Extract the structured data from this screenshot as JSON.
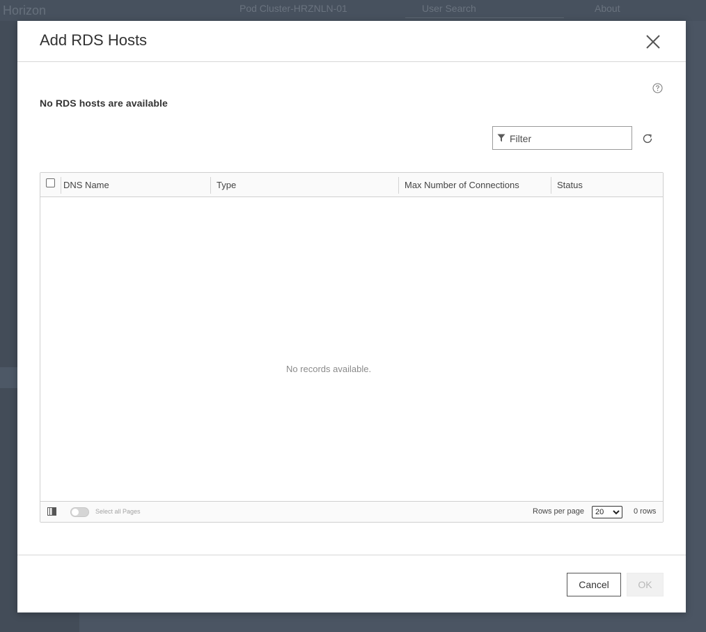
{
  "background": {
    "logo": "Horizon",
    "pod_name": "Pod Cluster-HRZNLN-01",
    "search_placeholder": "User Search",
    "about_label": "About"
  },
  "modal": {
    "title": "Add RDS Hosts",
    "message": "No RDS hosts are available",
    "filter_placeholder": "Filter",
    "table": {
      "columns": [
        "DNS Name",
        "Type",
        "Max Number of Connections",
        "Status"
      ],
      "rows": [],
      "empty_text": "No records available."
    },
    "footer": {
      "select_all_pages_label": "Select all Pages",
      "rows_per_page_label": "Rows per page",
      "rows_per_page_value": "20",
      "rows_per_page_options": [
        "20"
      ],
      "row_count_label": "0 rows"
    },
    "buttons": {
      "cancel": "Cancel",
      "ok": "OK"
    }
  },
  "icons": {
    "close": "close-icon",
    "help": "help-icon",
    "filter": "filter-icon",
    "refresh": "refresh-icon",
    "columns": "column-toggle-icon"
  }
}
